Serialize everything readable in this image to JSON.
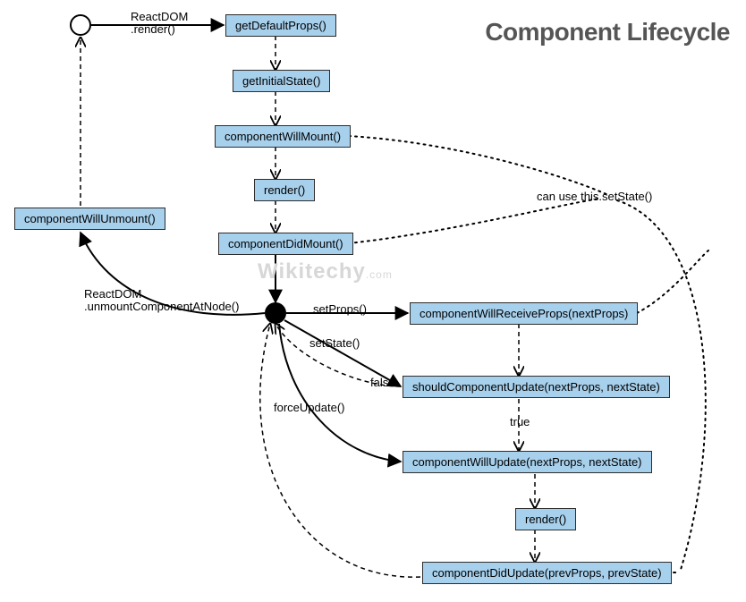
{
  "title": "Component Lifecycle",
  "watermark": {
    "main": "Wikitechy",
    "suffix": ".com"
  },
  "nodes": {
    "getDefaultProps": "getDefaultProps()",
    "getInitialState": "getInitialState()",
    "componentWillMount": "componentWillMount()",
    "render1": "render()",
    "componentDidMount": "componentDidMount()",
    "componentWillUnmount": "componentWillUnmount()",
    "componentWillReceiveProps": "componentWillReceiveProps(nextProps)",
    "shouldComponentUpdate": "shouldComponentUpdate(nextProps, nextState)",
    "componentWillUpdate": "componentWillUpdate(nextProps, nextState)",
    "render2": "render()",
    "componentDidUpdate": "componentDidUpdate(prevProps, prevState)"
  },
  "labels": {
    "reactdom_render": "ReactDOM\n.render()",
    "reactdom_unmount": "ReactDOM\n.unmountComponentAtNode()",
    "setProps": "setProps()",
    "setState": "setState()",
    "forceUpdate": "forceUpdate()",
    "false": "false",
    "true": "true",
    "canUseSetState": "can use this.setState()"
  }
}
